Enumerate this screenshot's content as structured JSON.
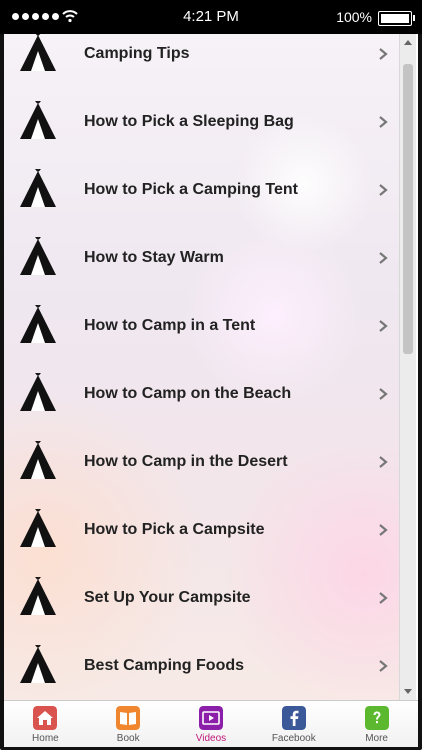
{
  "status_bar": {
    "time": "4:21 PM",
    "battery": "100%"
  },
  "list": {
    "items": [
      {
        "label": "Camping Tips"
      },
      {
        "label": "How to Pick a Sleeping Bag"
      },
      {
        "label": "How to Pick a Camping Tent"
      },
      {
        "label": "How to Stay Warm"
      },
      {
        "label": "How to Camp in a Tent"
      },
      {
        "label": "How to Camp on the Beach"
      },
      {
        "label": "How to Camp in the Desert"
      },
      {
        "label": "How to Pick a Campsite"
      },
      {
        "label": "Set Up Your Campsite"
      },
      {
        "label": "Best Camping Foods"
      }
    ]
  },
  "tabs": {
    "home": "Home",
    "book": "Book",
    "videos": "Videos",
    "facebook": "Facebook",
    "more": "More"
  },
  "colors": {
    "active_tab": "#c0197a"
  }
}
